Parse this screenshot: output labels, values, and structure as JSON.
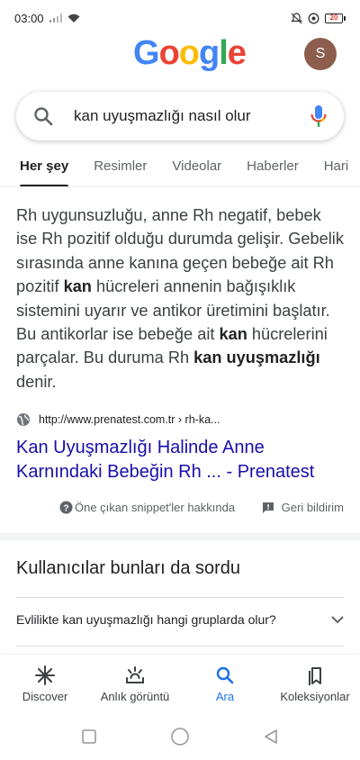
{
  "status_bar": {
    "time": "03:00",
    "battery": "20"
  },
  "header": {
    "logo_letters": [
      "G",
      "o",
      "o",
      "g",
      "l",
      "e"
    ],
    "avatar_initial": "S"
  },
  "search": {
    "query": "kan uyuşmazlığı nasıl olur"
  },
  "tabs": [
    "Her şey",
    "Resimler",
    "Videolar",
    "Haberler",
    "Hari"
  ],
  "snippet": {
    "part1": "Rh uygunsuzluğu, anne Rh negatif, bebek ise Rh pozitif olduğu durumda gelişir. Gebelik sırasında anne kanına geçen bebeğe ait Rh pozitif ",
    "bold1": "kan",
    "part2": " hücreleri annenin bağışıklık sistemini uyarır ve antikor üretimini başlatır. Bu antikorlar ise bebeğe ait ",
    "bold2": "kan",
    "part3": " hücrelerini parçalar. Bu duruma Rh ",
    "bold3": "kan uyuşmazlığı",
    "part4": " denir."
  },
  "result": {
    "url": "http://www.prenatest.com.tr › rh-ka...",
    "title": "Kan Uyuşmazlığı Halinde Anne Karnındaki Bebeğin Rh ... - Prenatest"
  },
  "snippet_footer": {
    "about": "Öne çıkan snippet'ler hakkında",
    "feedback": "Geri bildirim"
  },
  "paa": {
    "title": "Kullanıcılar bunları da sordu",
    "question": "Evlilikte kan uyuşmazlığı hangi gruplarda olur?"
  },
  "bottom_nav": [
    {
      "label": "Discover",
      "icon": "asterisk-icon"
    },
    {
      "label": "Anlık görüntü",
      "icon": "snapshot-icon"
    },
    {
      "label": "Ara",
      "icon": "search-icon"
    },
    {
      "label": "Koleksiyonlar",
      "icon": "collections-icon"
    }
  ],
  "colors": {
    "link": "#1a0dab",
    "active_nav": "#1a73e8",
    "avatar": "#8d5d4d"
  }
}
